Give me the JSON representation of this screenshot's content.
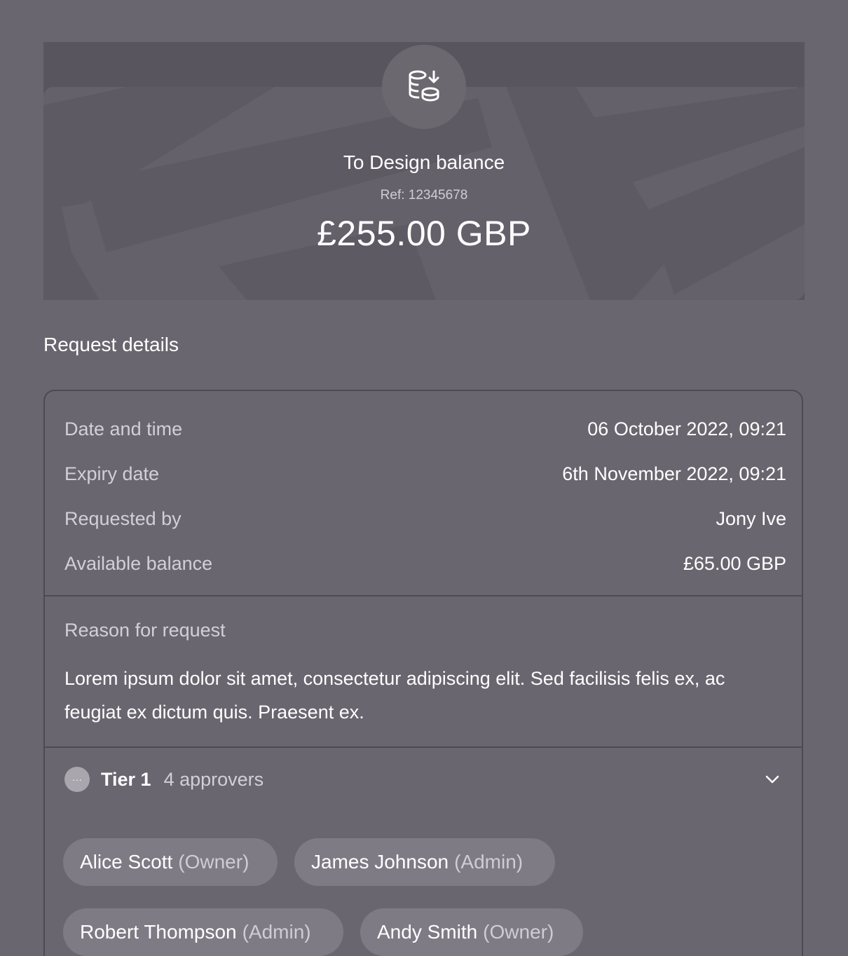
{
  "hero": {
    "title": "To Design balance",
    "ref": "Ref: 12345678",
    "amount": "£255.00 GBP",
    "icon": "coins-deposit-icon"
  },
  "section_title": "Request details",
  "details": [
    {
      "label": "Date and time",
      "value": "06 October 2022, 09:21"
    },
    {
      "label": "Expiry date",
      "value": "6th November 2022, 09:21"
    },
    {
      "label": "Requested by",
      "value": "Jony Ive"
    },
    {
      "label": "Available balance",
      "value": "£65.00 GBP"
    }
  ],
  "reason": {
    "label": "Reason for request",
    "text": "Lorem ipsum dolor sit amet, consectetur adipiscing elit. Sed facilisis felis ex, ac feugiat ex dictum quis. Praesent ex."
  },
  "tier": {
    "status_glyph": "···",
    "name": "Tier 1",
    "count": "4 approvers",
    "approvers": [
      {
        "name": "Alice Scott",
        "role": "(Owner)"
      },
      {
        "name": "James Johnson",
        "role": "(Admin)"
      },
      {
        "name": "Robert Thompson",
        "role": "(Admin)"
      },
      {
        "name": "Andy Smith",
        "role": "(Owner)"
      }
    ]
  },
  "colors": {
    "page_bg": "#69666f",
    "hero_bg": "#58555e",
    "chip_bg": "#7e7b85",
    "border": "#4d4a53"
  }
}
